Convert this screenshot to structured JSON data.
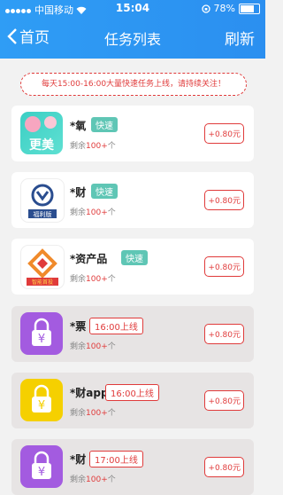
{
  "status_bar": {
    "carrier": "中国移动",
    "time": "15:04",
    "battery": "78%"
  },
  "header": {
    "back_label": "首页",
    "title": "任务列表",
    "refresh_label": "刷新"
  },
  "notice": "每天15:00-16:00大量快速任务上线，请持续关注！",
  "tasks": [
    {
      "name": "*氧",
      "tag": "快速",
      "remain_prefix": "剩余",
      "remain_num": "100+",
      "remain_suffix": "个",
      "price": "+0.80元",
      "icon": "app-gengmei-icon",
      "icon_text": "更美"
    },
    {
      "name": "*财",
      "tag": "快速",
      "remain_prefix": "剩余",
      "remain_num": "100+",
      "remain_suffix": "个",
      "price": "+0.80元",
      "icon": "app-finance-icon",
      "icon_text": "福利版"
    },
    {
      "name": "*资产品",
      "tag": "快速",
      "remain_prefix": "剩余",
      "remain_num": "100+",
      "remain_suffix": "个",
      "price": "+0.80元",
      "icon": "app-asset-icon",
      "icon_text": "智能首投"
    },
    {
      "name": "*票",
      "tag": "16:00上线",
      "remain_prefix": "剩余",
      "remain_num": "100+",
      "remain_suffix": "个",
      "price": "+0.80元",
      "icon": "lock-yen-icon"
    },
    {
      "name": "*财app",
      "tag": "16:00上线",
      "remain_prefix": "剩余",
      "remain_num": "100+",
      "remain_suffix": "个",
      "price": "+0.80元",
      "icon": "lock-yen-icon"
    },
    {
      "name": "*财",
      "tag": "17:00上线",
      "remain_prefix": "剩余",
      "remain_num": "100+",
      "remain_suffix": "个",
      "price": "+0.80元",
      "icon": "lock-yen-icon"
    }
  ]
}
